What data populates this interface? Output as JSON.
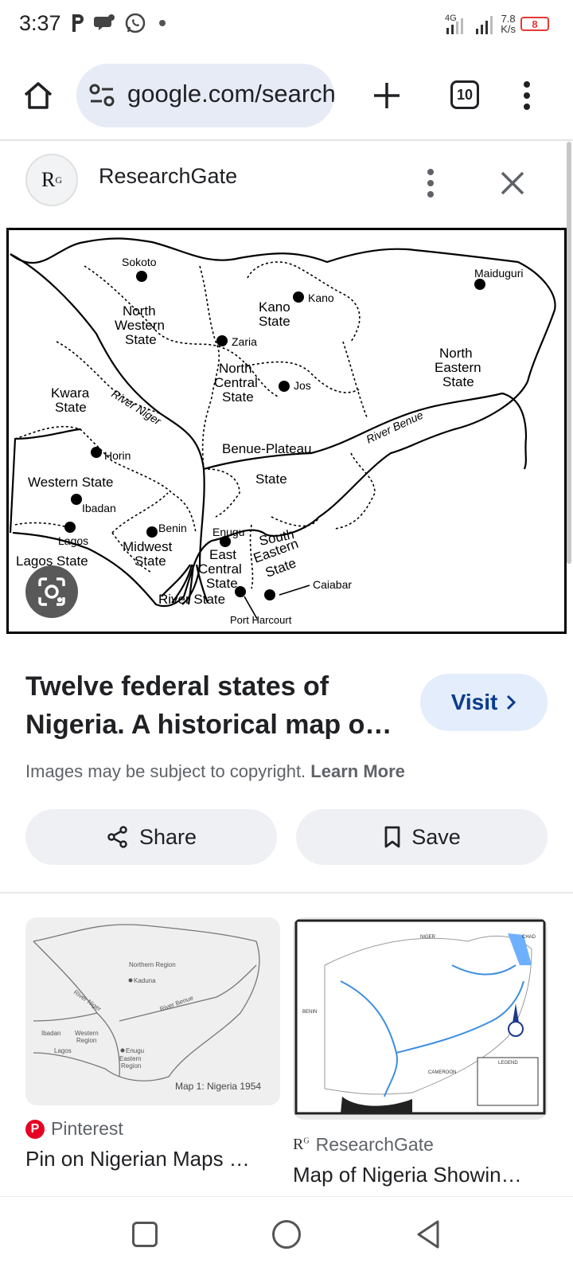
{
  "status_bar": {
    "time": "3:37",
    "network_type": "4G",
    "net_speed_value": "7.8",
    "net_speed_unit": "K/s",
    "battery": "8"
  },
  "toolbar": {
    "url": "google.com/search",
    "tab_count": "10"
  },
  "source": {
    "logo_text": "R",
    "logo_sup": "G",
    "name": "ResearchGate"
  },
  "map": {
    "labels": {
      "sokoto": "Sokoto",
      "nw1": "North",
      "nw2": "Western",
      "nw3": "State",
      "kano1": "Kano",
      "kano2": "State",
      "kano_city": "Kano",
      "zaria": "Zaria",
      "maiduguri": "Maiduguri",
      "nc1": "North",
      "nc2": "Central",
      "nc3": "State",
      "jos": "Jos",
      "ne1": "North",
      "ne2": "Eastern",
      "ne3": "State",
      "kwara1": "Kwara",
      "kwara2": "State",
      "river_niger": "River Niger",
      "river_benue": "River Benue",
      "horin": "Horin",
      "bp1": "Benue-Plateau",
      "bp2": "State",
      "western": "Western State",
      "ibadan": "Ibadan",
      "benin": "Benin",
      "enugu": "Enugu",
      "lagos": "Lagos",
      "lagos_state": "Lagos State",
      "mw1": "Midwest",
      "mw2": "State",
      "ec1": "East",
      "ec2": "Central",
      "ec3": "State",
      "se1": "South",
      "se2": "Eastern",
      "se3": "State",
      "calabar": "Caiabar",
      "river_state": "River State",
      "port_harcourt": "Port Harcourt"
    }
  },
  "result": {
    "title": "Twelve federal states of Nigeria. A historical map o…",
    "visit_label": "Visit",
    "copyright_text": "Images may be subject to copyright.",
    "learn_more": "Learn More",
    "share_label": "Share",
    "save_label": "Save"
  },
  "related": [
    {
      "source": "Pinterest",
      "title": "Pin on Nigerian Maps …",
      "caption": "Map 1: Nigeria 1954",
      "inner": {
        "northern": "Northern Region",
        "kaduna": "Kaduna",
        "niger": "River Niger",
        "benue": "River Benue",
        "western": "Western",
        "region": "Region",
        "ibadan": "Ibadan",
        "lagos": "Lagos",
        "enugu": "Enugu",
        "eastern": "Eastern",
        "eregion": "Region"
      }
    },
    {
      "source": "ResearchGate",
      "title": "Map of Nigeria Showin…",
      "inner": {
        "niger": "NIGER",
        "chad": "CHAD",
        "benin": "BENIN",
        "cameroon": "CAMEROON",
        "legend": "LEGEND"
      }
    }
  ],
  "colors": {
    "omnibox_bg": "#e7ebf6",
    "visit_bg": "#e3edfb",
    "visit_text": "#0b3b8c",
    "pinterest_red": "#e60023",
    "battery_red": "#e53935"
  }
}
